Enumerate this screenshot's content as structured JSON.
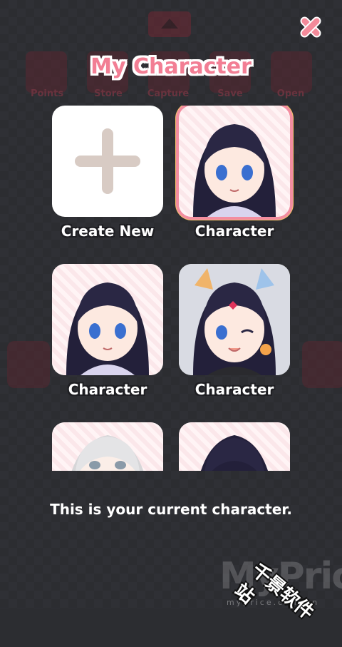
{
  "background_menu": {
    "items": [
      {
        "label": "Points",
        "icon": "cart-icon"
      },
      {
        "label": "Store",
        "icon": "cart-icon"
      },
      {
        "label": "Capture",
        "icon": "camera-icon"
      },
      {
        "label": "Save",
        "icon": "save-icon"
      },
      {
        "label": "Open",
        "icon": "open-icon"
      }
    ]
  },
  "dialog": {
    "title": "My Character",
    "close_icon": "close-icon",
    "create_label": "Create New",
    "characters": [
      {
        "label": "Character",
        "selected": true,
        "variant": "dark-bob"
      },
      {
        "label": "Character",
        "selected": false,
        "variant": "dark-bob"
      },
      {
        "label": "Character",
        "selected": false,
        "variant": "cat-ears-wink"
      },
      {
        "label": "",
        "selected": false,
        "variant": "silver-hair"
      },
      {
        "label": "",
        "selected": false,
        "variant": "dark-bob"
      }
    ],
    "message": "This is your current character."
  },
  "watermark": {
    "brand": "MyPrice",
    "site": "myprice.com.cn",
    "chinese": "千景软件站"
  },
  "colors": {
    "title_pink": "#f27e94",
    "selected_border": "#f38da0",
    "background": "#2c2d31",
    "plus_color": "#d8cbc4"
  }
}
